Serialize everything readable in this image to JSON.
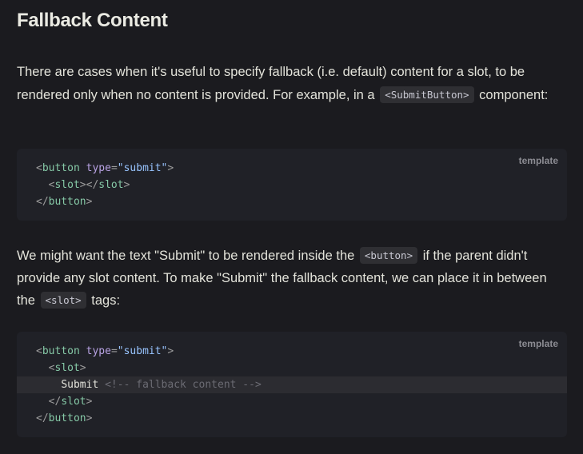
{
  "heading": "Fallback Content",
  "paragraph1": {
    "text_before": "There are cases when it's useful to specify fallback (i.e. default) content for a slot, to be rendered only when no content is provided. For example, in a",
    "code": "<SubmitButton>",
    "text_after": "component:"
  },
  "code_block1": {
    "lang": "template",
    "line1": {
      "open": "<",
      "tag": "button",
      "sp": " ",
      "attr": "type",
      "eq": "=",
      "val": "\"submit\"",
      "close": ">"
    },
    "line2": {
      "indent": "  ",
      "open": "<",
      "tag": "slot",
      "mid": "></",
      "tag2": "slot",
      "close": ">"
    },
    "line3": {
      "open": "</",
      "tag": "button",
      "close": ">"
    }
  },
  "paragraph2": {
    "text1": "We might want the text \"Submit\" to be rendered inside the",
    "code1": "<button>",
    "text2": "if the parent didn't provide any slot content. To make \"Submit\" the fallback content, we can place it in between the",
    "code2": "<slot>",
    "text3": "tags:"
  },
  "code_block2": {
    "lang": "template",
    "line1": {
      "open": "<",
      "tag": "button",
      "sp": " ",
      "attr": "type",
      "eq": "=",
      "val": "\"submit\"",
      "close": ">"
    },
    "line2": {
      "indent": "  ",
      "open": "<",
      "tag": "slot",
      "close": ">"
    },
    "line3": {
      "indent": "    ",
      "text": "Submit",
      "sp": " ",
      "comment": "<!-- fallback content -->"
    },
    "line4": {
      "indent": "  ",
      "open": "</",
      "tag": "slot",
      "close": ">"
    },
    "line5": {
      "open": "</",
      "tag": "button",
      "close": ">"
    }
  }
}
